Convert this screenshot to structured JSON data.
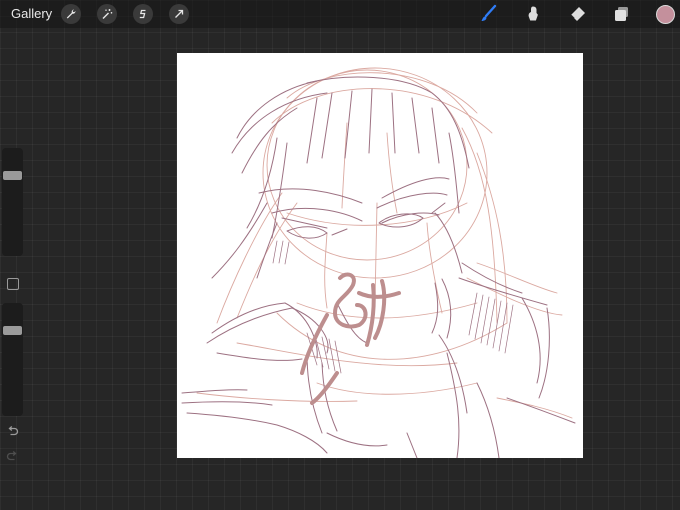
{
  "topbar": {
    "gallery_label": "Gallery",
    "left_tools": [
      "wrench-icon",
      "magic-wand-icon",
      "selection-icon",
      "transform-icon"
    ],
    "right_tools": [
      "brush-icon",
      "smudge-icon",
      "eraser-icon",
      "layers-icon"
    ],
    "active_tool": "brush-icon",
    "active_color": "#c4909c"
  },
  "sidebar": {
    "brush_size_level": 0.77,
    "opacity_level": 0.78,
    "controls": [
      "undo-icon",
      "redo-icon"
    ]
  },
  "canvas": {
    "background": "#ffffff",
    "artwork": "sketch-portrait"
  },
  "colors": {
    "sketch_light": "#dba9a1",
    "sketch_dark": "#9d7182",
    "sketch_bold": "#bd8e8e",
    "accent": "#2f7cf6"
  }
}
